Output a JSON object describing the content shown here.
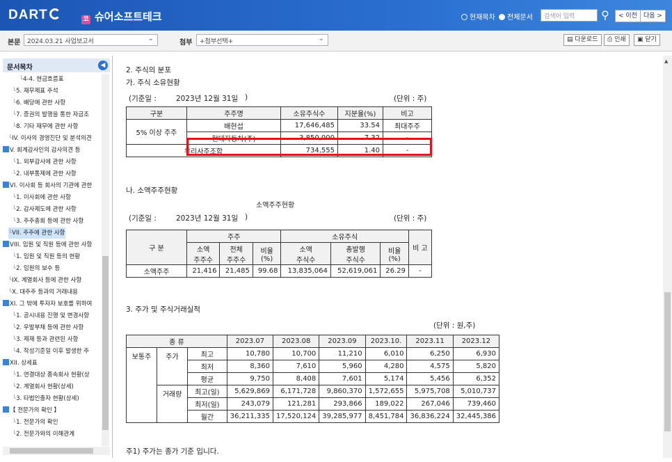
{
  "header": {
    "logo": "DART",
    "company": "슈어소프트테크",
    "company_icon": "코",
    "radio_current": "현재목차",
    "radio_all": "전체문서",
    "search_placeholder": "검색어 입력",
    "prev": "< 이전",
    "next": "다음 >"
  },
  "toolbar": {
    "report_label": "본문",
    "report_value": "2024.03.21  사업보고서",
    "attach_label": "첨부",
    "attach_value": "+첨부선택+",
    "download": "다운로드",
    "print": "인쇄",
    "close": "닫기"
  },
  "toc": {
    "title": "문서목차",
    "items": [
      {
        "label": "4-4. 현금흐름표",
        "level": 3
      },
      {
        "label": "5. 재무제표 주석",
        "level": 2
      },
      {
        "label": "6. 배당에 관한 사항",
        "level": 2
      },
      {
        "label": "7. 증권의 발행을 통한 자금조",
        "level": 2
      },
      {
        "label": "8. 기타 재무에 관한 사항",
        "level": 2
      },
      {
        "label": "IV. 이사의 경영진단 및 분석의견",
        "level": 1
      },
      {
        "label": "V. 회계감사인의 감사의견 등",
        "level": 0
      },
      {
        "label": "1. 외부감사에 관한 사항",
        "level": 2
      },
      {
        "label": "2. 내부통제에 관한 사항",
        "level": 2
      },
      {
        "label": "VI. 이사회 등 회사의 기관에 관한",
        "level": 0
      },
      {
        "label": "1. 이사회에 관한 사항",
        "level": 2
      },
      {
        "label": "2. 감사제도에 관한 사항",
        "level": 2
      },
      {
        "label": "3. 주주총회 등에 관한 사항",
        "level": 2
      },
      {
        "label": "VII. 주주에 관한 사항",
        "level": 1,
        "selected": true
      },
      {
        "label": "VIII. 임원 및 직원 등에 관한 사항",
        "level": 0
      },
      {
        "label": "1. 임원 및 직원 등의 현황",
        "level": 2
      },
      {
        "label": "2. 임원의 보수 등",
        "level": 2
      },
      {
        "label": "IX. 계열회사 등에 관한 사항",
        "level": 1
      },
      {
        "label": "X. 대주주 등과의 거래내용",
        "level": 1
      },
      {
        "label": "XI. 그 밖에 투자자 보호를 위하여",
        "level": 0
      },
      {
        "label": "1. 공시내용 진행 및 변경사항",
        "level": 2
      },
      {
        "label": "2. 우발부채 등에 관한 사항",
        "level": 2
      },
      {
        "label": "3. 제재 등과 관련된 사항",
        "level": 2
      },
      {
        "label": "4. 작성기준일 이후 발생한 주",
        "level": 2
      },
      {
        "label": "XII. 상세표",
        "level": 0
      },
      {
        "label": "1. 연결대상 종속회사 현황(상",
        "level": 2
      },
      {
        "label": "2. 계열회사 현황(상세)",
        "level": 2
      },
      {
        "label": "3. 타법인출자 현황(상세)",
        "level": 2
      },
      {
        "label": "【 전문가의 확인 】",
        "level": 0
      },
      {
        "label": "1. 전문가의 확인",
        "level": 2
      },
      {
        "label": "2. 전문가와의 이해관계",
        "level": 2
      }
    ]
  },
  "doc": {
    "sec2_title": "2. 주식의 분포",
    "sec2a_title": "가. 주식 소유현황",
    "base_date_label": "(기준일 :",
    "base_date": "2023년 12월 31일",
    "base_date_close": ")",
    "unit_shares": "(단위 : 주)",
    "own_headers": [
      "구분",
      "주주명",
      "소유주식수",
      "지분율(%)",
      "비고"
    ],
    "own_group": "5% 이상 주주",
    "own_rows": [
      {
        "name": "배현섭",
        "shares": "17,646,485",
        "ratio": "33.54",
        "note": "최대주주"
      },
      {
        "name": "현대자동차(주)",
        "shares": "3,850,000",
        "ratio": "7.32",
        "note": "-"
      }
    ],
    "own_union": {
      "name": "우리사주조합",
      "shares": "734,555",
      "ratio": "1.40",
      "note": "-"
    },
    "sec2b_title": "나. 소액주주현황",
    "minor_caption": "소액주주현황",
    "minor_headers": {
      "group": "구 분",
      "holders": "주주",
      "shares": "소유주식",
      "note": "비 고",
      "minor_holders": "소액\n주주수",
      "total_holders": "전체\n주주수",
      "ratio1": "비율\n(%)",
      "minor_shares": "소액\n주식수",
      "total_shares": "총발행\n주식수",
      "ratio2": "비율\n(%)"
    },
    "minor_row": [
      "소액주주",
      "21,416",
      "21,485",
      "99.68",
      "13,835,064",
      "52,619,061",
      "26.29",
      "-"
    ],
    "sec3_title": "3. 주가 및 주식거래실적",
    "unit_won": "(단위 : 원,주)",
    "price_kind": "종 류",
    "months": [
      "2023.07",
      "2023.08",
      "2023.09",
      "2023.10.",
      "2023.11",
      "2023.12"
    ],
    "stock_type": "보통주",
    "price_label": "주가",
    "volume_label": "거래량",
    "price_rows": [
      {
        "label": "최고",
        "values": [
          "10,780",
          "10,700",
          "11,210",
          "6,010",
          "6,250",
          "6,930"
        ]
      },
      {
        "label": "최저",
        "values": [
          "8,360",
          "7,610",
          "5,960",
          "4,280",
          "4,575",
          "5,820"
        ]
      },
      {
        "label": "평균",
        "values": [
          "9,750",
          "8,408",
          "7,601",
          "5,174",
          "5,456",
          "6,352"
        ]
      }
    ],
    "volume_rows": [
      {
        "label": "최고(일)",
        "values": [
          "5,629,869",
          "6,171,728",
          "9,860,370",
          "1,572,655",
          "5,975,708",
          "5,010,737"
        ]
      },
      {
        "label": "최저(일)",
        "values": [
          "243,079",
          "121,281",
          "293,866",
          "189,022",
          "267,046",
          "739,460"
        ]
      },
      {
        "label": "월간",
        "values": [
          "36,211,335",
          "17,520,124",
          "39,285,977",
          "8,451,784",
          "36,836,224",
          "32,445,386"
        ]
      }
    ],
    "footnote": "주1) 주가는 종가 기준 입니다."
  }
}
